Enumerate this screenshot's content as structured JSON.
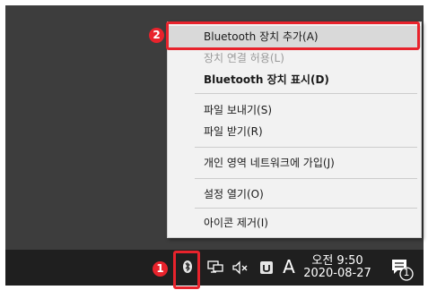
{
  "menu": {
    "items": [
      {
        "label": "Bluetooth 장치 추가(A)"
      },
      {
        "label": "장치 연결 허용(L)"
      },
      {
        "label": "Bluetooth 장치 표시(D)"
      },
      {
        "label": "파일 보내기(S)"
      },
      {
        "label": "파일 받기(R)"
      },
      {
        "label": "개인 영역 네트워크에 가입(J)"
      },
      {
        "label": "설정 열기(O)"
      },
      {
        "label": "아이콘 제거(I)"
      }
    ]
  },
  "callouts": {
    "first": "1",
    "second": "2"
  },
  "taskbar": {
    "ime_label": "A",
    "time": "오전 9:50",
    "date": "2020-08-27",
    "notification_count": "1"
  },
  "icons": {
    "bluetooth": "bluetooth-icon",
    "network": "network-icon",
    "volume": "volume-muted-icon",
    "app": "app-icon",
    "notification": "action-center-icon"
  },
  "colors": {
    "accent": "#e8232c",
    "menu_bg": "#f2f2f2",
    "taskbar": "#1f1f1f"
  }
}
